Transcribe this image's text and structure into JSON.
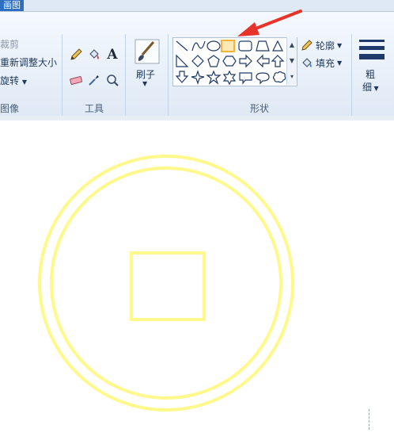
{
  "titlebar": {
    "tab_label": "画图"
  },
  "image_group": {
    "crop_label": "裁剪",
    "resize_label": "重新调整大小",
    "rotate_label": "旋转",
    "group_label": "图像"
  },
  "tools_group": {
    "group_label": "工具",
    "tools": [
      "pencil-icon",
      "fill-icon",
      "text-icon",
      "eraser-icon",
      "color-picker-icon",
      "magnifier-icon"
    ],
    "text_tool_glyph": "A"
  },
  "brush": {
    "label": "刷子"
  },
  "shapes_group": {
    "group_label": "形状",
    "shapes": [
      "line",
      "curve",
      "oval",
      "rectangle",
      "rounded-rectangle",
      "polygon",
      "triangle",
      "right-triangle",
      "diamond",
      "pentagon",
      "hexagon",
      "arrow-right",
      "arrow-left",
      "arrow-up",
      "arrow-down",
      "four-point-star",
      "five-point-star",
      "six-point-star",
      "callout-rect",
      "callout-oval",
      "callout-cloud"
    ],
    "selected_shape": "rectangle",
    "outline_label": "轮廓",
    "fill_label": "填充"
  },
  "size": {
    "label_top": "粗",
    "label_bottom": "细"
  },
  "colors": {
    "accent_arrow": "#e8332a",
    "drawing_stroke": "#fff88a",
    "selection_highlight": "#f4b43c"
  },
  "drawing": {
    "elements": [
      "outer-circle",
      "inner-circle",
      "square"
    ]
  }
}
